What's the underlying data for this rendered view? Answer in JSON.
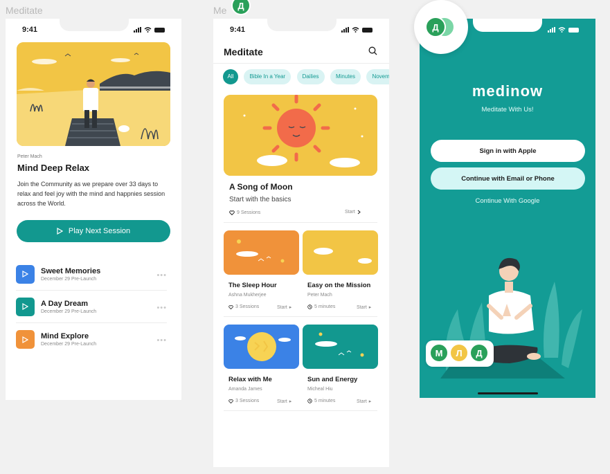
{
  "canvas": {
    "label_1": "Meditate",
    "label_2": "Me"
  },
  "status": {
    "time": "9:41"
  },
  "screen1": {
    "author": "Peter Mach",
    "title": "Mind Deep Relax",
    "description": "Join the Community as we prepare over 33 days to relax and feel joy with the mind and happnies session across the World.",
    "play_button": "Play Next Session",
    "items": [
      {
        "name": "Sweet Memories",
        "date": "December 29 Pre-Launch",
        "color": "#3b82e6"
      },
      {
        "name": "A Day Dream",
        "date": "December 29 Pre-Launch",
        "color": "#12988f"
      },
      {
        "name": "Mind Explore",
        "date": "December 29 Pre-Launch",
        "color": "#f0923a"
      }
    ],
    "more": "•••"
  },
  "screen2": {
    "title": "Meditate",
    "chips": [
      "All",
      "Bible In a Year",
      "Dailies",
      "Minutes",
      "Novem"
    ],
    "featured": {
      "title": "A Song of Moon",
      "subtitle": "Start with the basics",
      "sessions": "9 Sessions",
      "start": "Start"
    },
    "cards": [
      {
        "title": "The Sleep Hour",
        "author": "Ashna Mukherjee",
        "meta": "3 Sessions",
        "start": "Start"
      },
      {
        "title": "Easy on the Mission",
        "author": "Peter Mach",
        "meta": "5 minutes",
        "start": "Start"
      },
      {
        "title": "Relax with Me",
        "author": "Amanda James",
        "meta": "3 Sessions",
        "start": "Start"
      },
      {
        "title": "Sun and Energy",
        "author": "Micheal Hiu",
        "meta": "5 minutes",
        "start": "Start"
      }
    ]
  },
  "screen3": {
    "logo": "medinow",
    "tagline": "Meditate With Us!",
    "apple_button": "Sign in with Apple",
    "email_button": "Continue with Email or Phone",
    "google_link": "Continue With Google"
  },
  "avatars": {
    "top_d": "Д",
    "bubble_d": "Д",
    "group": [
      "М",
      "Л",
      "Д"
    ]
  },
  "colors": {
    "teal": "#12988f",
    "yellow": "#f2c545",
    "orange": "#f0923a",
    "blue": "#3b82e6",
    "light_teal": "#d4f6f5"
  }
}
